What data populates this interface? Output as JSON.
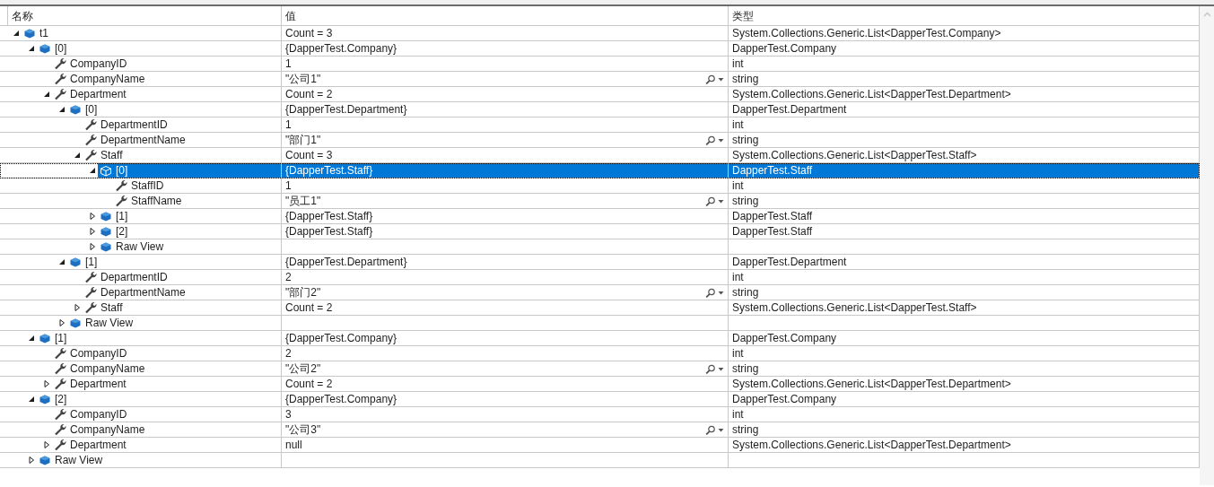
{
  "columns": [
    "名称",
    "值",
    "类型"
  ],
  "tree": [
    {
      "name": "t1",
      "value": "Count = 3",
      "type": "System.Collections.Generic.List<DapperTest.Company>",
      "kind": "object",
      "expanded": true,
      "selected": false,
      "children": [
        {
          "name": "[0]",
          "value": "{DapperTest.Company}",
          "type": "DapperTest.Company",
          "kind": "object",
          "expanded": true,
          "selected": false,
          "children": [
            {
              "name": "CompanyID",
              "value": "1",
              "type": "int",
              "kind": "property",
              "selected": false
            },
            {
              "name": "CompanyName",
              "value": "\"公司1\"",
              "type": "string",
              "kind": "property",
              "selected": false,
              "inspect": true
            },
            {
              "name": "Department",
              "value": "Count = 2",
              "type": "System.Collections.Generic.List<DapperTest.Department>",
              "kind": "property",
              "expanded": true,
              "selected": false,
              "children": [
                {
                  "name": "[0]",
                  "value": "{DapperTest.Department}",
                  "type": "DapperTest.Department",
                  "kind": "object",
                  "expanded": true,
                  "selected": false,
                  "children": [
                    {
                      "name": "DepartmentID",
                      "value": "1",
                      "type": "int",
                      "kind": "property",
                      "selected": false
                    },
                    {
                      "name": "DepartmentName",
                      "value": "\"部门1\"",
                      "type": "string",
                      "kind": "property",
                      "selected": false,
                      "inspect": true
                    },
                    {
                      "name": "Staff",
                      "value": "Count = 3",
                      "type": "System.Collections.Generic.List<DapperTest.Staff>",
                      "kind": "property",
                      "expanded": true,
                      "selected": false,
                      "children": [
                        {
                          "name": "[0]",
                          "value": "{DapperTest.Staff}",
                          "type": "DapperTest.Staff",
                          "kind": "object",
                          "expanded": true,
                          "selected": true,
                          "children": [
                            {
                              "name": "StaffID",
                              "value": "1",
                              "type": "int",
                              "kind": "property",
                              "selected": false
                            },
                            {
                              "name": "StaffName",
                              "value": "\"员工1\"",
                              "type": "string",
                              "kind": "property",
                              "selected": false,
                              "inspect": true
                            }
                          ]
                        },
                        {
                          "name": "[1]",
                          "value": "{DapperTest.Staff}",
                          "type": "DapperTest.Staff",
                          "kind": "object",
                          "expanded": false,
                          "selected": false
                        },
                        {
                          "name": "[2]",
                          "value": "{DapperTest.Staff}",
                          "type": "DapperTest.Staff",
                          "kind": "object",
                          "expanded": false,
                          "selected": false
                        },
                        {
                          "name": "Raw View",
                          "kind": "object",
                          "expanded": false,
                          "selected": false
                        }
                      ]
                    }
                  ]
                },
                {
                  "name": "[1]",
                  "value": "{DapperTest.Department}",
                  "type": "DapperTest.Department",
                  "kind": "object",
                  "expanded": true,
                  "selected": false,
                  "children": [
                    {
                      "name": "DepartmentID",
                      "value": "2",
                      "type": "int",
                      "kind": "property",
                      "selected": false
                    },
                    {
                      "name": "DepartmentName",
                      "value": "\"部门2\"",
                      "type": "string",
                      "kind": "property",
                      "selected": false,
                      "inspect": true
                    },
                    {
                      "name": "Staff",
                      "value": "Count = 2",
                      "type": "System.Collections.Generic.List<DapperTest.Staff>",
                      "kind": "property",
                      "expanded": false,
                      "selected": false
                    }
                  ]
                },
                {
                  "name": "Raw View",
                  "kind": "object",
                  "expanded": false,
                  "selected": false
                }
              ]
            }
          ]
        },
        {
          "name": "[1]",
          "value": "{DapperTest.Company}",
          "type": "DapperTest.Company",
          "kind": "object",
          "expanded": true,
          "selected": false,
          "children": [
            {
              "name": "CompanyID",
              "value": "2",
              "type": "int",
              "kind": "property",
              "selected": false
            },
            {
              "name": "CompanyName",
              "value": "\"公司2\"",
              "type": "string",
              "kind": "property",
              "selected": false,
              "inspect": true
            },
            {
              "name": "Department",
              "value": "Count = 2",
              "type": "System.Collections.Generic.List<DapperTest.Department>",
              "kind": "property",
              "expanded": false,
              "selected": false
            }
          ]
        },
        {
          "name": "[2]",
          "value": "{DapperTest.Company}",
          "type": "DapperTest.Company",
          "kind": "object",
          "expanded": true,
          "selected": false,
          "children": [
            {
              "name": "CompanyID",
              "value": "3",
              "type": "int",
              "kind": "property",
              "selected": false
            },
            {
              "name": "CompanyName",
              "value": "\"公司3\"",
              "type": "string",
              "kind": "property",
              "selected": false,
              "inspect": true
            },
            {
              "name": "Department",
              "value": "null",
              "type": "System.Collections.Generic.List<DapperTest.Department>",
              "kind": "property",
              "expanded": false,
              "selected": false
            }
          ]
        },
        {
          "name": "Raw View",
          "kind": "object",
          "expanded": false,
          "selected": false
        }
      ]
    }
  ]
}
